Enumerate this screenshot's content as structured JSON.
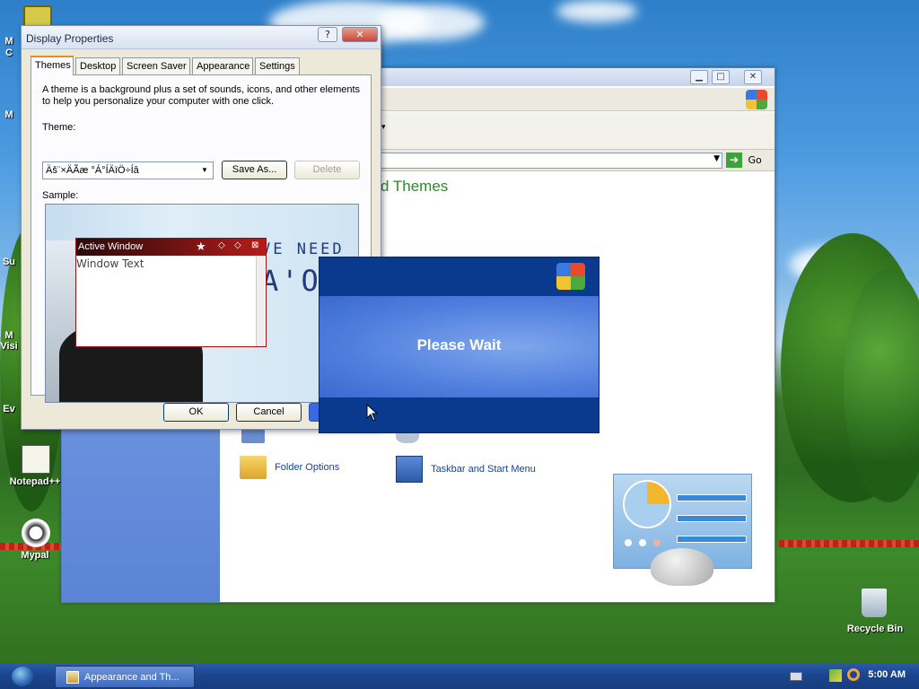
{
  "desktop": {
    "icons": [
      {
        "label": "Notepad++"
      },
      {
        "label": "Mypal"
      },
      {
        "label": "Recycle Bin"
      }
    ],
    "partial_labels": [
      "M",
      "C",
      "M",
      "Su",
      "M",
      "Visi",
      "Ev"
    ]
  },
  "background_window": {
    "heading": "d Themes",
    "go_label": "Go",
    "tasks": [
      {
        "label": "Folder Options"
      },
      {
        "label": "Taskbar and Start Menu"
      }
    ]
  },
  "display_properties": {
    "title": "Display Properties",
    "help_btn": "?",
    "close_btn": "✕",
    "tabs": [
      "Themes",
      "Desktop",
      "Screen Saver",
      "Appearance",
      "Settings"
    ],
    "active_tab": "Themes",
    "description": "A theme is a background plus a set of sounds, icons, and other elements to help you personalize your computer with one click.",
    "theme_label": "Theme:",
    "theme_value": "Äš¨×ÄÃæ °Á°ÍÄïÖ÷Íâ",
    "save_as": "Save As...",
    "delete": "Delete",
    "sample_label": "Sample:",
    "sample": {
      "active_window_title": "Active Window",
      "window_text": "Window Text",
      "poster_line1": "VE NEED",
      "poster_line2": "A'O°"
    },
    "ok": "OK",
    "cancel": "Cancel"
  },
  "please_wait": {
    "message": "Please Wait"
  },
  "taskbar": {
    "task_label": "Appearance and Th...",
    "clock": "5:00 AM"
  },
  "colors": {
    "xp_blue": "#0a3a8e",
    "heading_green": "#2d8a2d",
    "active_window_red": "#b41c1c"
  }
}
